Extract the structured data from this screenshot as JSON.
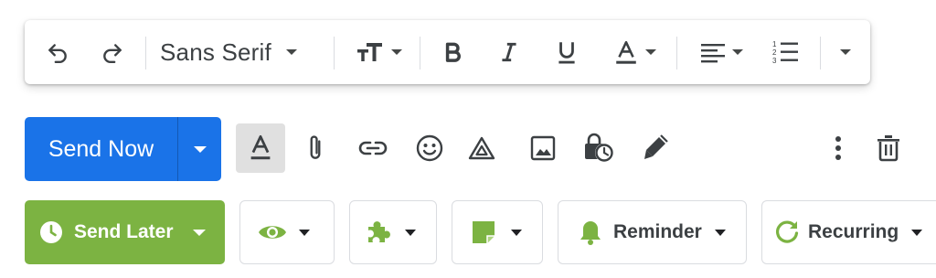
{
  "toolbar": {
    "undo_icon": "undo-icon",
    "redo_icon": "redo-icon",
    "font_family": "Sans Serif",
    "size_icon": "text-size-icon",
    "bold_icon": "bold-icon",
    "italic_icon": "italic-icon",
    "underline_icon": "underline-icon",
    "text_color_icon": "text-color-icon",
    "align_icon": "align-left-icon",
    "numbered_list_icon": "numbered-list-icon",
    "more_icon": "chevron-down-icon"
  },
  "send_row": {
    "send_now_label": "Send Now",
    "icons": [
      "formatting-options-icon",
      "attach-icon",
      "link-icon",
      "emoji-icon",
      "drive-icon",
      "photo-icon",
      "confidential-mode-icon",
      "signature-icon",
      "more-options-icon",
      "trash-icon"
    ],
    "send_now_color": "#1a73e8"
  },
  "plugin_row": {
    "send_later_label": "Send Later",
    "reminder_label": "Reminder",
    "recurring_label": "Recurring",
    "accent_color": "#7cb342"
  }
}
